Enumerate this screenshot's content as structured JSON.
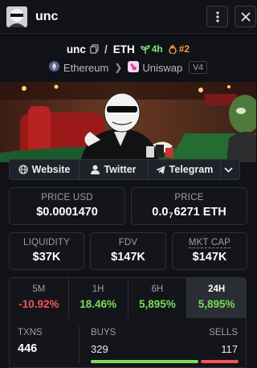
{
  "header": {
    "title": "unc",
    "menu_icon": "kebab-menu-icon",
    "close_icon": "close-icon"
  },
  "pair": {
    "base": "unc",
    "separator": "/",
    "quote": "ETH",
    "trend_label": "4h",
    "rank_label": "#2",
    "trend_color": "#7ee37a",
    "rank_color": "#f0a13a"
  },
  "chain": {
    "network": "Ethereum",
    "dex": "Uniswap",
    "version": "V4"
  },
  "links": {
    "website": "Website",
    "twitter": "Twitter",
    "telegram": "Telegram"
  },
  "stats": {
    "price_usd_label": "PRICE USD",
    "price_usd": "$0.0001470",
    "price_label": "PRICE",
    "price_prefix": "0.0",
    "price_zero_count": "7",
    "price_digits": "6271 ETH",
    "liquidity_label": "LIQUIDITY",
    "liquidity": "$37K",
    "fdv_label": "FDV",
    "fdv": "$147K",
    "mktcap_label": "MKT CAP",
    "mktcap": "$147K"
  },
  "timeframes": [
    {
      "label": "5M",
      "value": "-10.92%"
    },
    {
      "label": "1H",
      "value": "18.46%"
    },
    {
      "label": "6H",
      "value": "5,895%"
    },
    {
      "label": "24H",
      "value": "5,895%"
    }
  ],
  "txns": {
    "label": "TXNS",
    "value": "446",
    "buys_label": "BUYS",
    "buys": "329",
    "sells_label": "SELLS",
    "sells": "117",
    "buy_share": 0.738
  },
  "colors": {
    "positive": "#7bdc5a",
    "negative": "#f2555a",
    "background": "#111217"
  }
}
